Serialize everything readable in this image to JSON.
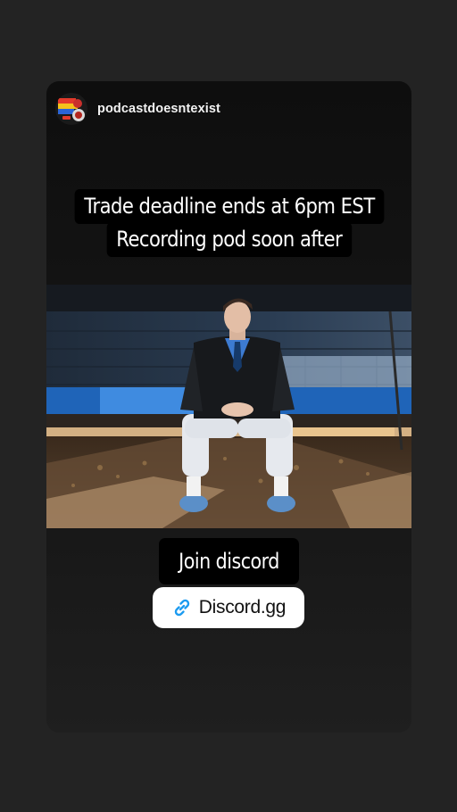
{
  "story": {
    "username": "podcastdoesntexist",
    "avatar_icon": "podcast-logo-avatar",
    "caption_lines": [
      "Trade deadline ends at 6pm EST",
      "Recording pod soon after"
    ],
    "join_label": "Join discord",
    "link": {
      "icon": "link-icon",
      "text": "Discord.gg",
      "accent": "#1d9bf0"
    }
  },
  "colors": {
    "background": "#232323",
    "card": "#121212",
    "caption_bg": "#000000",
    "sticker_bg": "#ffffff"
  }
}
